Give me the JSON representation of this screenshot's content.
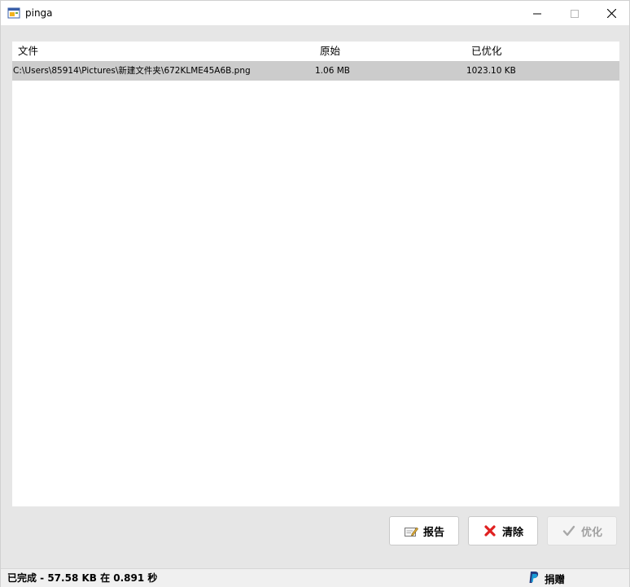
{
  "window": {
    "title": "pinga"
  },
  "table": {
    "headers": {
      "file": "文件",
      "original": "原始",
      "optimized": "已优化"
    },
    "rows": [
      {
        "file": "C:\\Users\\85914\\Pictures\\新建文件夹\\672KLME45A6B.png",
        "original": "1.06 MB",
        "optimized": "1023.10 KB"
      }
    ]
  },
  "buttons": {
    "report": "报告",
    "clear": "清除",
    "optimize": "优化"
  },
  "status": {
    "text": "已完成 - 57.58 KB 在 0.891 秒",
    "donate": "捐赠"
  },
  "icons": {
    "app": "app-window-icon",
    "report": "report-edit-icon",
    "clear": "red-x-icon",
    "optimize": "check-icon",
    "paypal": "paypal-icon"
  },
  "colors": {
    "accent_red": "#e02020",
    "paypal_blue": "#253b80",
    "paypal_light": "#179bd7",
    "row_selected": "#cccccc"
  }
}
